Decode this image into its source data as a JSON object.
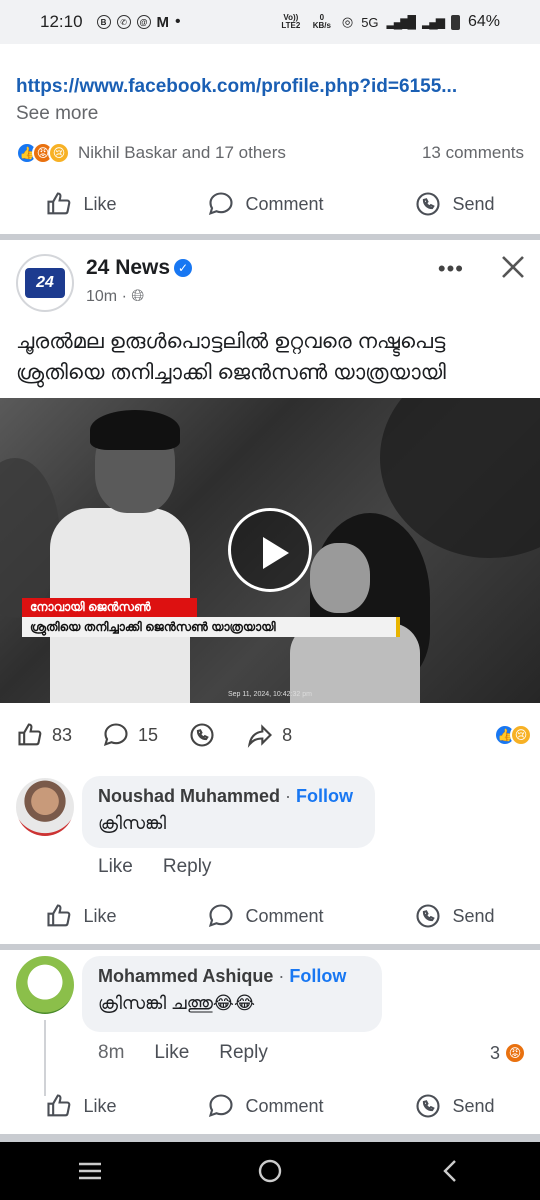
{
  "status_bar": {
    "time": "12:10",
    "left_icons": [
      "b-icon",
      "whatsapp-icon",
      "threads-icon",
      "gmail-icon"
    ],
    "dot": "•",
    "volte": "Vo)) LTE2",
    "speed_value": "0",
    "speed_unit": "KB/s",
    "network": "5G",
    "battery": "64%"
  },
  "prev_post": {
    "link": "https://www.facebook.com/profile.php?id=6155...",
    "see_more": "See more",
    "reactions_names": "Nikhil Baskar and 17 others",
    "comments_count": "13 comments"
  },
  "actions": {
    "like": "Like",
    "comment": "Comment",
    "send": "Send"
  },
  "post": {
    "page_name": "24 News",
    "logo_text": "24",
    "time": "10m",
    "more": "•••",
    "text": "ചൂരൽമല ഉരുൾപൊട്ടലിൽ ഉറ്റവരെ നഷ്ടപെട്ട ശ്രുതിയെ തനിച്ചാക്കി ജെൻസൺ യാത്രയായി",
    "video": {
      "ticker_top": "നോവായി ജെൻസൺ",
      "ticker_bottom": "ശ്രുതിയെ തനിച്ചാക്കി ജെൻസൺ യാത്രയായി",
      "date": "Sep 11, 2024, 10:42:32 pm"
    },
    "stats": {
      "likes": "83",
      "comments": "15",
      "shares": "8"
    }
  },
  "comments": [
    {
      "name": "Noushad Muhammed",
      "follow": "Follow",
      "separator": "·",
      "text": "ക്രിസങ്കി",
      "like": "Like",
      "reply": "Reply"
    },
    {
      "name": "Mohammed Ashique",
      "follow": "Follow",
      "separator": "·",
      "text": "ക്രിസങ്കി ചത്തു😂😂",
      "time": "8m",
      "like": "Like",
      "reply": "Reply",
      "reaction_count": "3"
    }
  ],
  "colors": {
    "facebook_blue": "#1877f2",
    "link_blue": "#1a5fb4",
    "divider": "#c9ccd1"
  }
}
